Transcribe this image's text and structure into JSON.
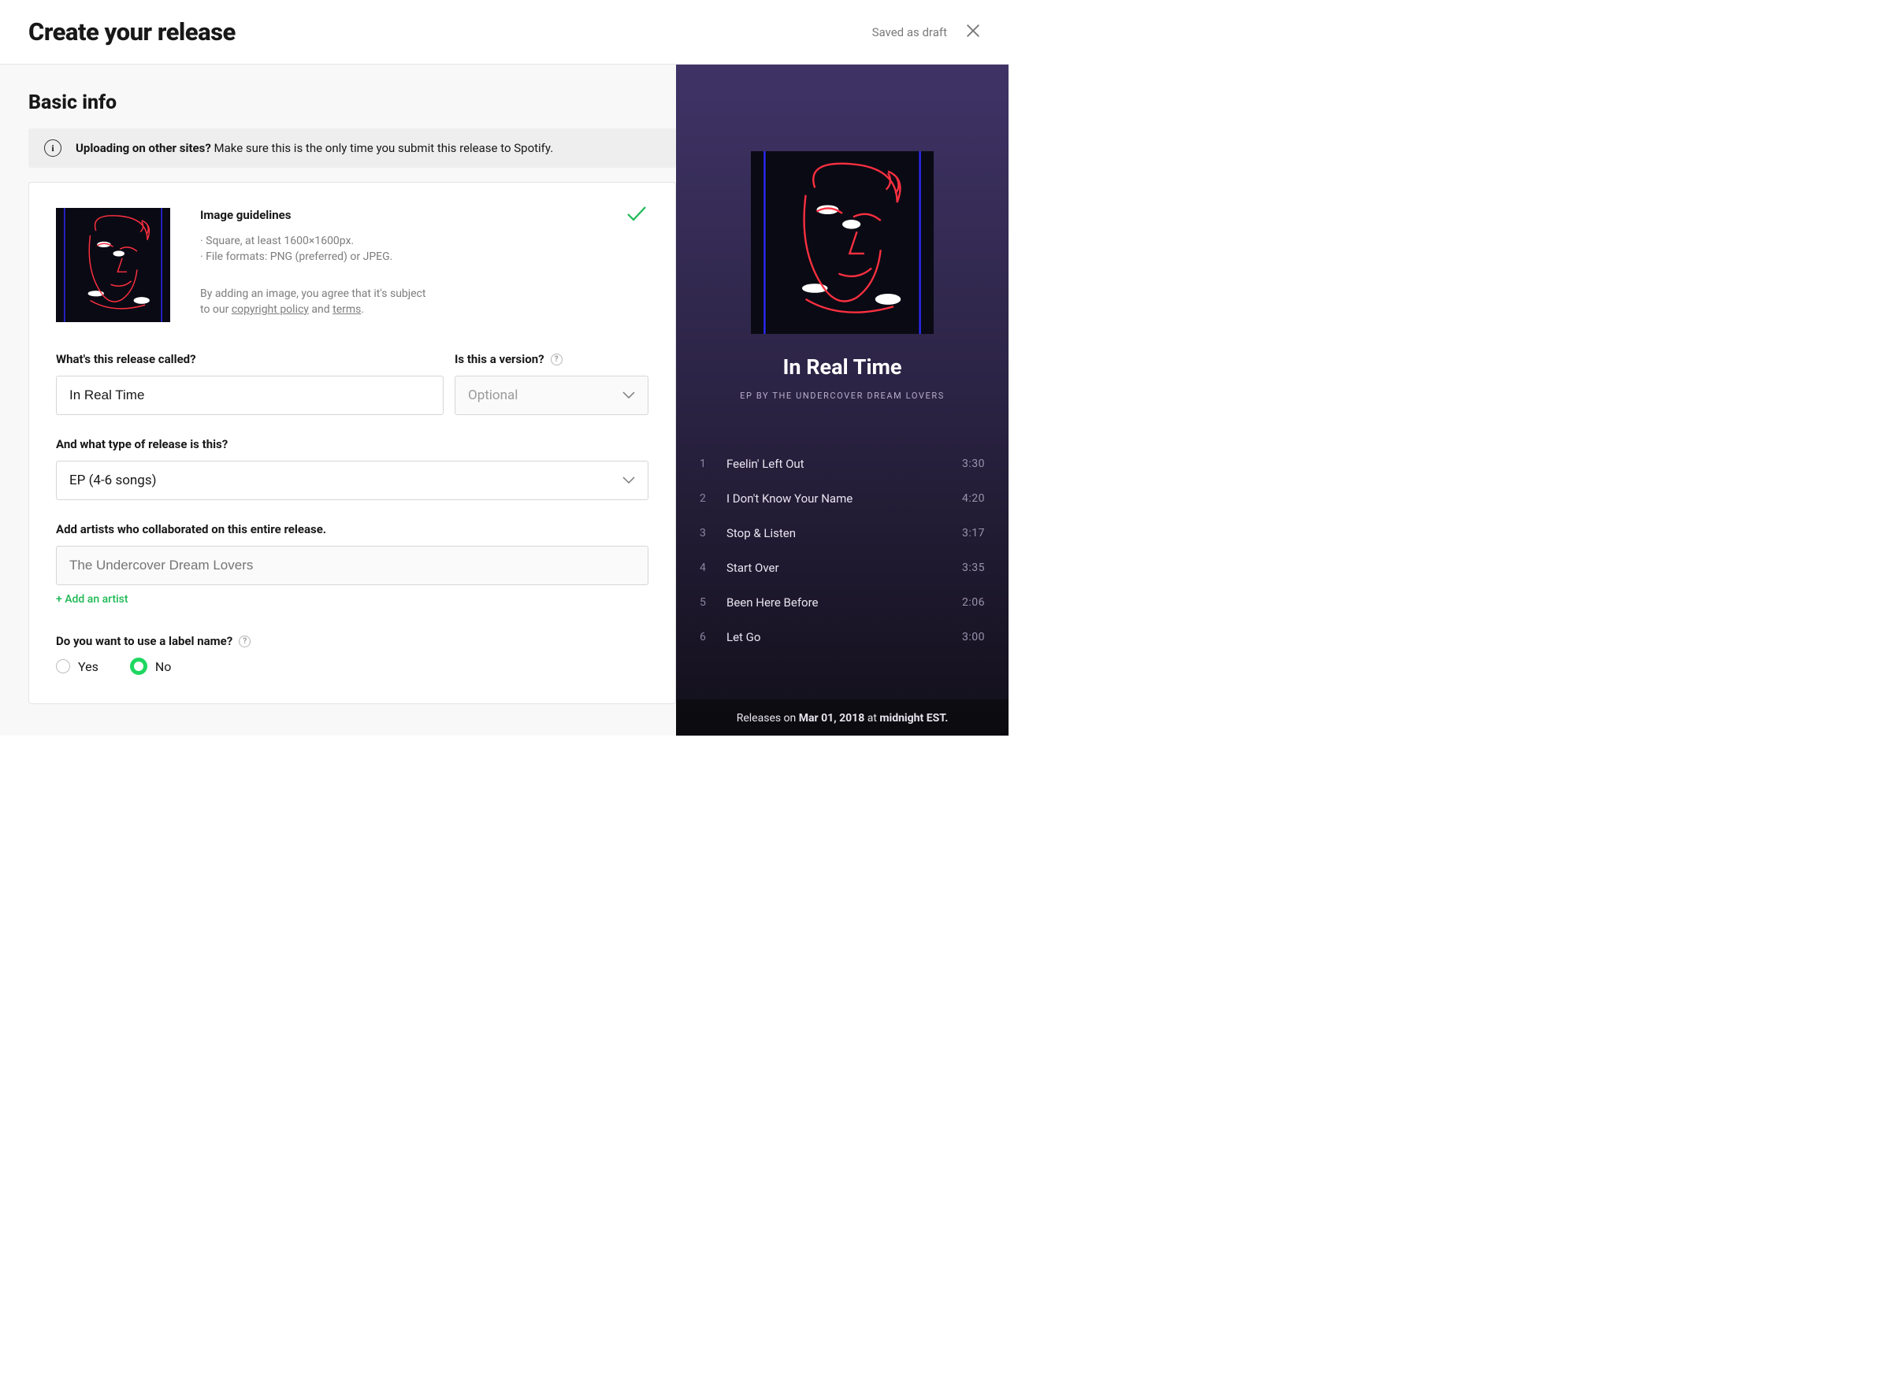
{
  "header": {
    "title": "Create your release",
    "status": "Saved as draft"
  },
  "section": {
    "heading": "Basic info",
    "notice_strong": "Uploading on other sites?",
    "notice_rest": " Make sure this is the only time you submit this release to Spotify."
  },
  "image": {
    "guidelines_heading": "Image guidelines",
    "rule_1": "· Square, at least 1600×1600px.",
    "rule_2": "· File formats: PNG (preferred) or JPEG.",
    "consent_pre": "By adding an image, you agree that it's subject to our ",
    "copyright_link": "copyright policy",
    "consent_mid": " and ",
    "terms_link": "terms",
    "consent_post": "."
  },
  "form": {
    "name_label": "What's this release called?",
    "name_value": "In Real Time",
    "version_label": "Is this a version?",
    "version_placeholder": "Optional",
    "type_label": "And what type of release is this?",
    "type_value": "EP (4-6 songs)",
    "collab_label": "Add artists who collaborated on this entire release.",
    "collab_placeholder": "The Undercover Dream Lovers",
    "add_artist": "+ Add an artist",
    "label_q": "Do you want to use a label name?",
    "yes": "Yes",
    "no": "No"
  },
  "preview": {
    "title": "In Real Time",
    "byline": "EP BY THE UNDERCOVER DREAM LOVERS",
    "tracks": [
      {
        "n": "1",
        "name": "Feelin' Left Out",
        "dur": "3:30"
      },
      {
        "n": "2",
        "name": "I Don't Know Your Name",
        "dur": "4:20"
      },
      {
        "n": "3",
        "name": "Stop & Listen",
        "dur": "3:17"
      },
      {
        "n": "4",
        "name": "Start Over",
        "dur": "3:35"
      },
      {
        "n": "5",
        "name": "Been Here Before",
        "dur": "2:06"
      },
      {
        "n": "6",
        "name": "Let Go",
        "dur": "3:00"
      }
    ],
    "release_pre": "Releases on ",
    "release_date": "Mar 01, 2018",
    "release_mid": " at ",
    "release_time": "midnight EST."
  }
}
